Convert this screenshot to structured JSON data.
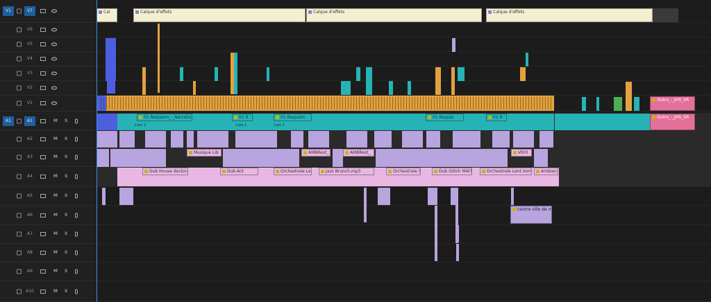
{
  "tracks": {
    "video": [
      {
        "name": "V7",
        "source": "V1",
        "targeted": true
      },
      {
        "name": "V6"
      },
      {
        "name": "V5"
      },
      {
        "name": "V4"
      },
      {
        "name": "V3"
      },
      {
        "name": "V2"
      },
      {
        "name": "V1"
      }
    ],
    "audio": [
      {
        "name": "A1",
        "source": "A1",
        "targeted": true
      },
      {
        "name": "A2"
      },
      {
        "name": "A3"
      },
      {
        "name": "A4"
      },
      {
        "name": "A5"
      },
      {
        "name": "A6"
      },
      {
        "name": "A7"
      },
      {
        "name": "A8"
      },
      {
        "name": "A9"
      },
      {
        "name": "A10"
      }
    ],
    "mute_label": "M",
    "solo_label": "S"
  },
  "clips": {
    "adjustment_1": "Cal",
    "adjustment_2": "Calque d'effets",
    "adjustment_3": "Calque d'effets",
    "adjustment_4": "Calque d'effets",
    "outro_video": "Outro_-_JHS_SR",
    "outro_audio": "Outro_-_JHS_SR",
    "a1_labels": [
      "01 Requiem_-_Narration.wav",
      "01 R",
      "01 Requiem",
      "01 Requie",
      "01 R",
      "01 Requiem",
      "01 R"
    ],
    "cam_labels": [
      "Cam 3",
      "Cam 1",
      "Cam 1",
      "Cam 1",
      "Cam 3"
    ],
    "a3_labels": [
      "Musique Lib",
      "AMBRest_",
      "AMBRest_",
      "VEHI"
    ],
    "a4_labels": [
      "Dub House doctor-v",
      "Dub Act",
      "Orchestrale Len",
      "Jazz Brunch.mp3",
      "Orchestrale Sav",
      "Dub Glitch MAITT",
      "Orchestrale Lent Immersed.",
      "Ambien"
    ],
    "a6_label": "centre ville de m"
  },
  "colors": {
    "playhead": "#3f8fe0",
    "video_clip": "#e3a23e",
    "audio_teal": "#27b3b6",
    "audio_music": "#e9b7e3",
    "audio_sfx": "#b8a4de",
    "outro": "#e4709a",
    "adjustment_layer": "#f3f0d2",
    "track_target": "#1f5f9d"
  },
  "icons": [
    "lock-icon",
    "film-icon",
    "eye-icon",
    "mic-icon",
    "fx-badge-icon"
  ]
}
